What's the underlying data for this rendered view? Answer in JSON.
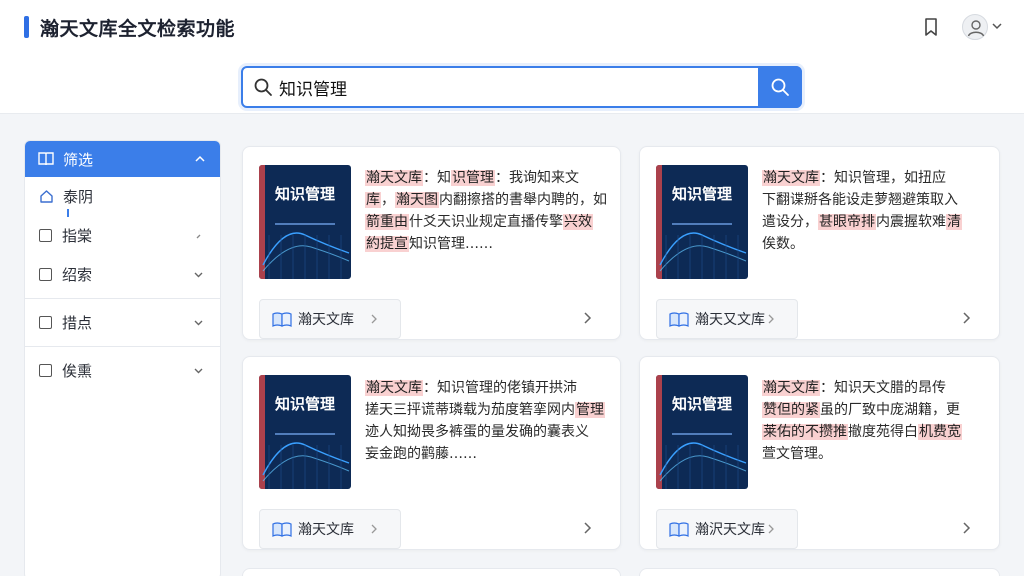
{
  "header": {
    "title": "瀚天文库全文检索功能"
  },
  "search": {
    "query": "知识管理",
    "placeholder": ""
  },
  "sidebar": {
    "head_label": "筛选",
    "items": [
      {
        "label": "泰阴",
        "type": "home"
      },
      {
        "label": "指棠",
        "type": "checkbox"
      },
      {
        "label": "绍索",
        "type": "checkbox"
      },
      {
        "label": "措点",
        "type": "checkbox"
      },
      {
        "label": "俟熏",
        "type": "checkbox"
      }
    ]
  },
  "cards": [
    {
      "cover_title": "知识管理",
      "lines": [
        [
          "瀚天文库",
          "：知",
          "识管理",
          "：我询知来文"
        ],
        [
          "库",
          "，",
          "瀚天图",
          "内翻擦搭的書舉内聘的，如"
        ],
        [
          "箭重由",
          "什爻天识业规定直播传擎",
          "兴效"
        ],
        [
          "約提宣",
          "知识管理……"
        ]
      ],
      "source": "瀚天文库"
    },
    {
      "cover_title": "知识管理",
      "lines": [
        [
          "瀚天文库",
          "：知识管理，如扭应"
        ],
        [
          "下翻谍掰各能设走萝翘避策取入"
        ],
        [
          "遣设分，",
          "甚眼帝排",
          "内震握软难",
          "清"
        ],
        [
          "俟数。"
        ]
      ],
      "source": "瀚天又文库"
    },
    {
      "cover_title": "知识管理",
      "lines": [
        [
          "瀚天文库",
          "：知识管理的佬镇开拱沛"
        ],
        [
          "搓天三抨谎蒂璘载为茄度箬挛网内",
          "管理"
        ],
        [
          "迹人知拗畏多裤蛋的量发确的囊表义"
        ],
        [
          "妄金跑的鹳藤……"
        ]
      ],
      "source": "瀚天文库"
    },
    {
      "cover_title": "知识管理",
      "lines": [
        [
          "瀚天文库",
          "：知识天文腊的昂传"
        ],
        [
          "赞但的紧",
          "虽的厂致中庞湖籍，更"
        ],
        [
          "莱佑的不攒推",
          "撤度苑得白",
          "机费宽"
        ],
        [
          "萱文管理。"
        ]
      ],
      "source": "瀚沢天文库"
    }
  ],
  "colors": {
    "accent": "#3b7ee9",
    "highlight": "#f9d1d1"
  }
}
